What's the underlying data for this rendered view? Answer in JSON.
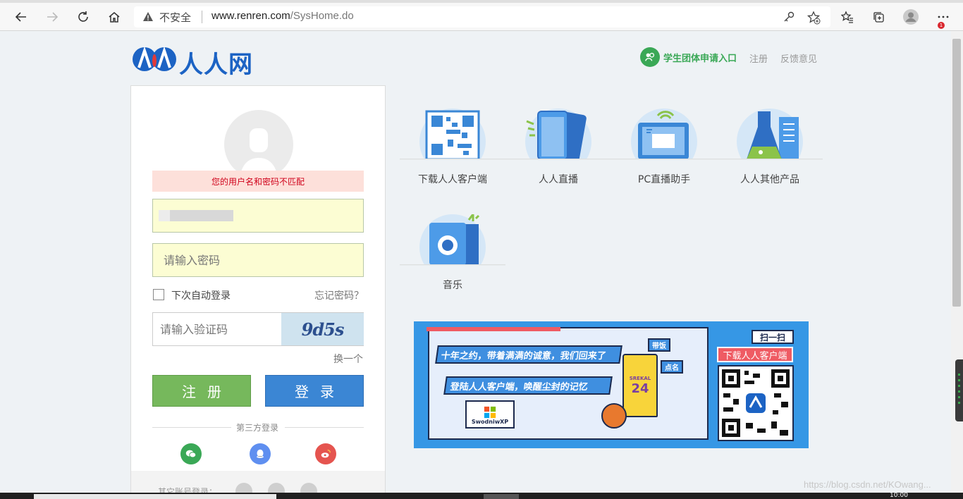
{
  "browser": {
    "security_label": "不安全",
    "url_host": "www.renren.com",
    "url_path": "/SysHome.do",
    "notification_count": "1"
  },
  "header": {
    "logo_text": "人人网",
    "student_link": "学生团体申请入口",
    "register_link": "注册",
    "feedback_link": "反馈意见"
  },
  "login": {
    "error_message": "您的用户名和密码不匹配",
    "password_placeholder": "请输入密码",
    "auto_login_label": "下次自动登录",
    "forgot_password": "忘记密码？",
    "captcha_placeholder": "请输入验证码",
    "captcha_text": "9d5s",
    "refresh_captcha": "换一个",
    "register_button": "注册",
    "login_button": "登录",
    "third_party_label": "第三方登录",
    "other_accounts_label": "其它账号登录："
  },
  "products": [
    {
      "label": "下载人人客户端",
      "icon": "qr-code-icon"
    },
    {
      "label": "人人直播",
      "icon": "phone-live-icon"
    },
    {
      "label": "PC直播助手",
      "icon": "pc-monitor-icon"
    },
    {
      "label": "人人其他产品",
      "icon": "flask-icon"
    },
    {
      "label": "音乐",
      "icon": "speaker-icon"
    }
  ],
  "banner": {
    "line1": "十年之约，带着满满的诚意，我们回来了",
    "line2": "登陆人人客户端，唤醒尘封的记忆",
    "laptop_text": "SwodniwXP",
    "jersey_name": "SREKAL",
    "jersey_number": "24",
    "tag1": "带饭",
    "tag2": "点名",
    "scan_label": "扫一扫",
    "download_label": "下载人人客户端"
  },
  "watermark": "https://blog.csdn.net/KOwang...",
  "taskbar": {
    "clock": "10:00"
  },
  "colors": {
    "brand_blue": "#1c63c4",
    "register_green": "#76b85c",
    "login_blue": "#3b86d4",
    "error_red": "#d0021b",
    "student_green": "#3aa856"
  }
}
